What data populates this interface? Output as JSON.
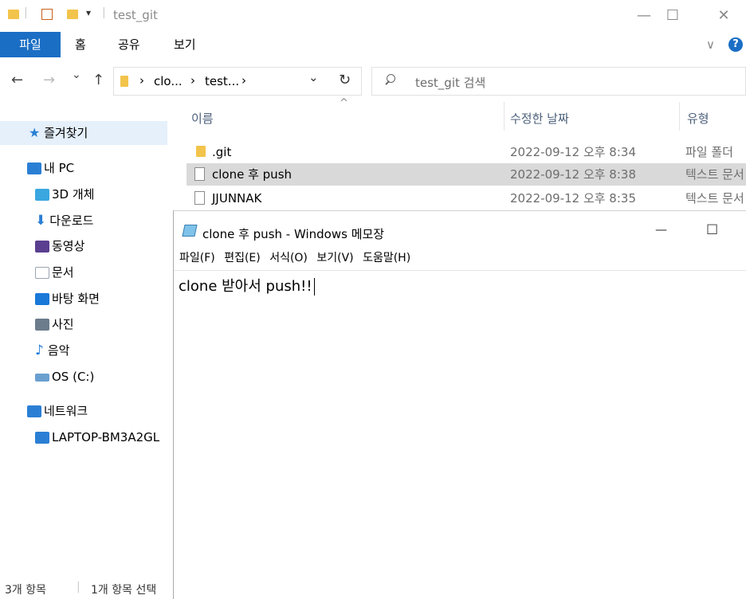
{
  "window": {
    "title": "test_git",
    "minimize": "—",
    "maximize": "☐",
    "close": "✕"
  },
  "ribbon": {
    "tabs": [
      "파일",
      "홈",
      "공유",
      "보기"
    ],
    "expand": "∨",
    "help": "?"
  },
  "address": {
    "back": "←",
    "forward": "→",
    "recent": "⌄",
    "up": "↑",
    "path": [
      "clo...",
      "test..."
    ],
    "sep": "›",
    "dropdown": "⌄",
    "refresh": "↻",
    "search_placeholder": "test_git 검색"
  },
  "sidebar": {
    "items": [
      {
        "label": "즐겨찾기",
        "icon": "star-icon",
        "color": "#2a7fd4"
      },
      {
        "label": "내 PC",
        "icon": "pc-icon",
        "color": "#2a7fd4"
      },
      {
        "label": "3D 개체",
        "icon": "cube-icon",
        "color": "#3aa7e0"
      },
      {
        "label": "다운로드",
        "icon": "download-icon",
        "color": "#2a7fd4"
      },
      {
        "label": "동영상",
        "icon": "video-icon",
        "color": "#5a3e8f"
      },
      {
        "label": "문서",
        "icon": "document-icon",
        "color": "#9aa4b0"
      },
      {
        "label": "바탕 화면",
        "icon": "desktop-icon",
        "color": "#1a78d8"
      },
      {
        "label": "사진",
        "icon": "pictures-icon",
        "color": "#6c7c8c"
      },
      {
        "label": "음악",
        "icon": "music-icon",
        "color": "#1a78d8"
      },
      {
        "label": "OS (C:)",
        "icon": "drive-icon",
        "color": "#6aa0d0"
      },
      {
        "label": "네트워크",
        "icon": "network-icon",
        "color": "#2a7fd4"
      },
      {
        "label": "LAPTOP-BM3A2GL",
        "icon": "computer-icon",
        "color": "#2a7fd4"
      }
    ]
  },
  "columns": {
    "name": "이름",
    "modified": "수정한 날짜",
    "type": "유형",
    "sort": "^"
  },
  "files": [
    {
      "name": ".git",
      "modified": "2022-09-12 오후 8:34",
      "type": "파일 폴더",
      "icon": "folder-icon"
    },
    {
      "name": "clone 후 push",
      "modified": "2022-09-12 오후 8:38",
      "type": "텍스트 문서",
      "icon": "text-file-icon"
    },
    {
      "name": "JJUNNAK",
      "modified": "2022-09-12 오후 8:35",
      "type": "텍스트 문서",
      "icon": "text-file-icon"
    }
  ],
  "status": {
    "count": "3개 항목",
    "selected": "1개 항목 선택"
  },
  "notepad": {
    "title": "clone 후 push - Windows 메모장",
    "minimize": "—",
    "maximize": "☐",
    "menu": [
      "파일(F)",
      "편집(E)",
      "서식(O)",
      "보기(V)",
      "도움말(H)"
    ],
    "content": "clone 받아서 push!!"
  },
  "colors": {
    "accent": "#1a6ec4",
    "selected_row": "#cce8ff",
    "folder": "#f3c44b"
  }
}
